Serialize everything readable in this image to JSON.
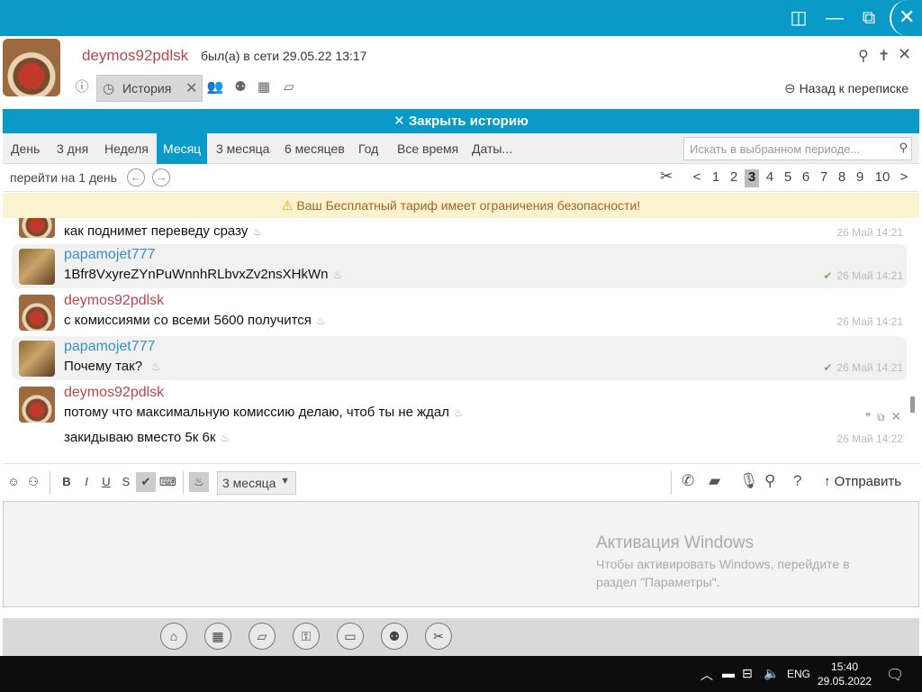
{
  "header": {
    "contact_name": "deymos92pdlsk",
    "contact_status": "был(а) в сети 29.05.22 13:17",
    "history_tab": "История",
    "back_link": "Назад к переписке"
  },
  "close_history": "✕ Закрыть историю",
  "periods": [
    "День",
    "3 дня",
    "Неделя",
    "Месяц",
    "3 месяца",
    "6 месяцев",
    "Год",
    "Все время",
    "Даты..."
  ],
  "active_period": "Месяц",
  "search_placeholder": "Искать в выбранном периоде...",
  "pager": {
    "goto_label": "перейти на 1 день",
    "prev": "<",
    "next": ">",
    "pages": [
      "1",
      "2",
      "3",
      "4",
      "5",
      "6",
      "7",
      "8",
      "9",
      "10"
    ],
    "current": "3"
  },
  "warning": "Ваш Бесплатный тариф имеет ограничения безопасности!",
  "messages": [
    {
      "author": "",
      "text": "как поднимет переведу сразу",
      "time": "26 Май 14:21",
      "delivered": false
    },
    {
      "author": "papamojet777",
      "text": "1Bfr8VxyreZYnPuWnnhRLbvxZv2nsXHkWn",
      "time": "26 Май 14:21",
      "delivered": true
    },
    {
      "author": "deymos92pdlsk",
      "text": "с комиссиями со всеми 5600 получится",
      "time": "26 Май 14:21",
      "delivered": false
    },
    {
      "author": "papamojet777",
      "text": "Почему так?",
      "time": "26 Май 14:21",
      "delivered": true
    },
    {
      "author": "deymos92pdlsk",
      "text": "потому что максимальную комиссию делаю, чтоб ты не ждал",
      "time": "",
      "delivered": false
    },
    {
      "author": "",
      "text": "закидываю вместо 5к 6к",
      "time": "26 Май 14:22",
      "delivered": false
    }
  ],
  "composer": {
    "period_select": "3 месяца",
    "send_label": "Отправить",
    "format_buttons": [
      "B",
      "I",
      "U",
      "S"
    ]
  },
  "activation": {
    "title": "Активация Windows",
    "line1": "Чтобы активировать Windows, перейдите в",
    "line2": "раздел \"Параметры\"."
  },
  "taskbar": {
    "lang": "ENG",
    "time": "15:40",
    "date": "29.05.2022"
  },
  "colors": {
    "accent": "#0a9ac7",
    "author_self": "#b8474f",
    "author_other": "#3a8fc0",
    "warning_bg": "#fbf2cf"
  }
}
